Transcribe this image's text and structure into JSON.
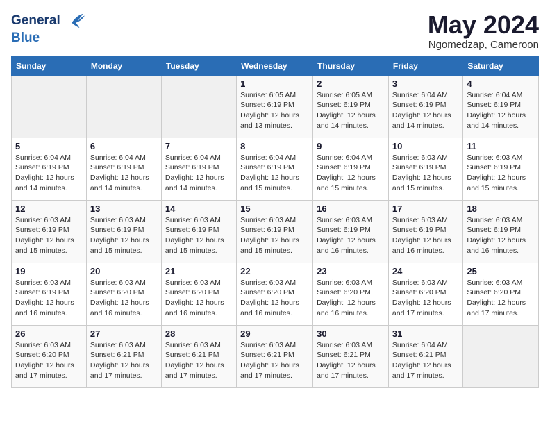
{
  "logo": {
    "line1": "General",
    "line2": "Blue"
  },
  "title": "May 2024",
  "location": "Ngomedzap, Cameroon",
  "weekdays": [
    "Sunday",
    "Monday",
    "Tuesday",
    "Wednesday",
    "Thursday",
    "Friday",
    "Saturday"
  ],
  "weeks": [
    [
      {
        "day": "",
        "info": ""
      },
      {
        "day": "",
        "info": ""
      },
      {
        "day": "",
        "info": ""
      },
      {
        "day": "1",
        "info": "Sunrise: 6:05 AM\nSunset: 6:19 PM\nDaylight: 12 hours\nand 13 minutes."
      },
      {
        "day": "2",
        "info": "Sunrise: 6:05 AM\nSunset: 6:19 PM\nDaylight: 12 hours\nand 14 minutes."
      },
      {
        "day": "3",
        "info": "Sunrise: 6:04 AM\nSunset: 6:19 PM\nDaylight: 12 hours\nand 14 minutes."
      },
      {
        "day": "4",
        "info": "Sunrise: 6:04 AM\nSunset: 6:19 PM\nDaylight: 12 hours\nand 14 minutes."
      }
    ],
    [
      {
        "day": "5",
        "info": "Sunrise: 6:04 AM\nSunset: 6:19 PM\nDaylight: 12 hours\nand 14 minutes."
      },
      {
        "day": "6",
        "info": "Sunrise: 6:04 AM\nSunset: 6:19 PM\nDaylight: 12 hours\nand 14 minutes."
      },
      {
        "day": "7",
        "info": "Sunrise: 6:04 AM\nSunset: 6:19 PM\nDaylight: 12 hours\nand 14 minutes."
      },
      {
        "day": "8",
        "info": "Sunrise: 6:04 AM\nSunset: 6:19 PM\nDaylight: 12 hours\nand 15 minutes."
      },
      {
        "day": "9",
        "info": "Sunrise: 6:04 AM\nSunset: 6:19 PM\nDaylight: 12 hours\nand 15 minutes."
      },
      {
        "day": "10",
        "info": "Sunrise: 6:03 AM\nSunset: 6:19 PM\nDaylight: 12 hours\nand 15 minutes."
      },
      {
        "day": "11",
        "info": "Sunrise: 6:03 AM\nSunset: 6:19 PM\nDaylight: 12 hours\nand 15 minutes."
      }
    ],
    [
      {
        "day": "12",
        "info": "Sunrise: 6:03 AM\nSunset: 6:19 PM\nDaylight: 12 hours\nand 15 minutes."
      },
      {
        "day": "13",
        "info": "Sunrise: 6:03 AM\nSunset: 6:19 PM\nDaylight: 12 hours\nand 15 minutes."
      },
      {
        "day": "14",
        "info": "Sunrise: 6:03 AM\nSunset: 6:19 PM\nDaylight: 12 hours\nand 15 minutes."
      },
      {
        "day": "15",
        "info": "Sunrise: 6:03 AM\nSunset: 6:19 PM\nDaylight: 12 hours\nand 15 minutes."
      },
      {
        "day": "16",
        "info": "Sunrise: 6:03 AM\nSunset: 6:19 PM\nDaylight: 12 hours\nand 16 minutes."
      },
      {
        "day": "17",
        "info": "Sunrise: 6:03 AM\nSunset: 6:19 PM\nDaylight: 12 hours\nand 16 minutes."
      },
      {
        "day": "18",
        "info": "Sunrise: 6:03 AM\nSunset: 6:19 PM\nDaylight: 12 hours\nand 16 minutes."
      }
    ],
    [
      {
        "day": "19",
        "info": "Sunrise: 6:03 AM\nSunset: 6:19 PM\nDaylight: 12 hours\nand 16 minutes."
      },
      {
        "day": "20",
        "info": "Sunrise: 6:03 AM\nSunset: 6:20 PM\nDaylight: 12 hours\nand 16 minutes."
      },
      {
        "day": "21",
        "info": "Sunrise: 6:03 AM\nSunset: 6:20 PM\nDaylight: 12 hours\nand 16 minutes."
      },
      {
        "day": "22",
        "info": "Sunrise: 6:03 AM\nSunset: 6:20 PM\nDaylight: 12 hours\nand 16 minutes."
      },
      {
        "day": "23",
        "info": "Sunrise: 6:03 AM\nSunset: 6:20 PM\nDaylight: 12 hours\nand 16 minutes."
      },
      {
        "day": "24",
        "info": "Sunrise: 6:03 AM\nSunset: 6:20 PM\nDaylight: 12 hours\nand 17 minutes."
      },
      {
        "day": "25",
        "info": "Sunrise: 6:03 AM\nSunset: 6:20 PM\nDaylight: 12 hours\nand 17 minutes."
      }
    ],
    [
      {
        "day": "26",
        "info": "Sunrise: 6:03 AM\nSunset: 6:20 PM\nDaylight: 12 hours\nand 17 minutes."
      },
      {
        "day": "27",
        "info": "Sunrise: 6:03 AM\nSunset: 6:21 PM\nDaylight: 12 hours\nand 17 minutes."
      },
      {
        "day": "28",
        "info": "Sunrise: 6:03 AM\nSunset: 6:21 PM\nDaylight: 12 hours\nand 17 minutes."
      },
      {
        "day": "29",
        "info": "Sunrise: 6:03 AM\nSunset: 6:21 PM\nDaylight: 12 hours\nand 17 minutes."
      },
      {
        "day": "30",
        "info": "Sunrise: 6:03 AM\nSunset: 6:21 PM\nDaylight: 12 hours\nand 17 minutes."
      },
      {
        "day": "31",
        "info": "Sunrise: 6:04 AM\nSunset: 6:21 PM\nDaylight: 12 hours\nand 17 minutes."
      },
      {
        "day": "",
        "info": ""
      }
    ]
  ]
}
